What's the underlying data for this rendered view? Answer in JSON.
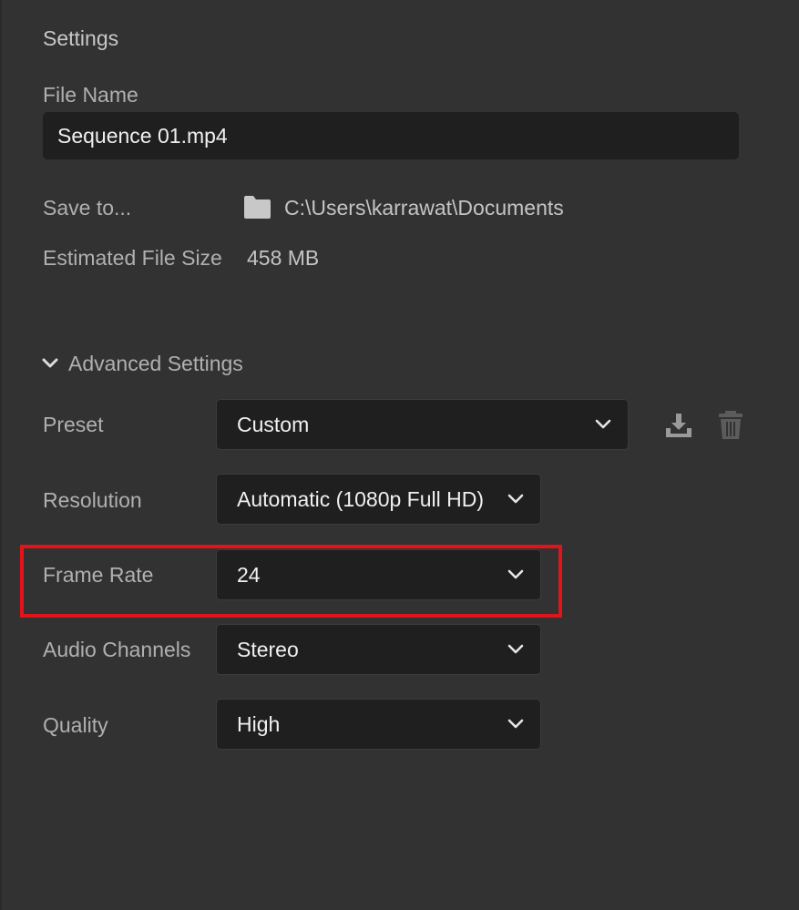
{
  "panel": {
    "section_title": "Settings",
    "file_name": {
      "label": "File Name",
      "value": "Sequence 01.mp4"
    },
    "save_to": {
      "label": "Save to...",
      "path": "C:\\Users\\karrawat\\Documents",
      "icon": "folder-icon"
    },
    "estimated_size": {
      "label": "Estimated File Size",
      "value": "458 MB"
    },
    "advanced": {
      "label": "Advanced Settings",
      "expanded": true,
      "icon": "chevron-down-icon"
    },
    "preset": {
      "label": "Preset",
      "value": "Custom",
      "save_icon": "save-preset-icon",
      "delete_icon": "trash-icon"
    },
    "resolution": {
      "label": "Resolution",
      "value": "Automatic (1080p Full HD)"
    },
    "frame_rate": {
      "label": "Frame Rate",
      "value": "24",
      "highlighted": true
    },
    "audio_channels": {
      "label": "Audio Channels",
      "value": "Stereo"
    },
    "quality": {
      "label": "Quality",
      "value": "High"
    }
  },
  "colors": {
    "background": "#323232",
    "field_background": "#1f1f1f",
    "label_text": "#b0b0b0",
    "value_text": "#f0f0f0",
    "highlight": "#e0141a"
  }
}
